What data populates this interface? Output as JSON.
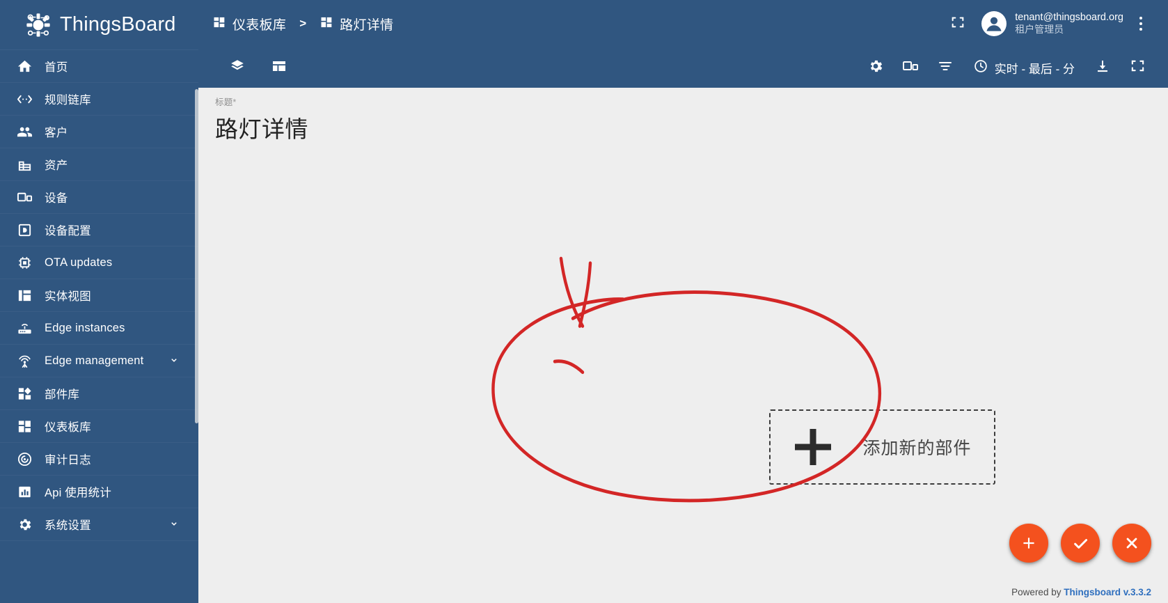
{
  "brand": {
    "name": "ThingsBoard",
    "logo_icon": "thingsboard-logo-icon"
  },
  "sidebar": {
    "items": [
      {
        "label": "首页",
        "icon": "home-icon",
        "expandable": false
      },
      {
        "label": "规则链库",
        "icon": "rule-chain-icon",
        "expandable": false
      },
      {
        "label": "客户",
        "icon": "customers-icon",
        "expandable": false
      },
      {
        "label": "资产",
        "icon": "assets-icon",
        "expandable": false
      },
      {
        "label": "设备",
        "icon": "devices-icon",
        "expandable": false
      },
      {
        "label": "设备配置",
        "icon": "device-profile-icon",
        "expandable": false
      },
      {
        "label": "OTA updates",
        "icon": "ota-chip-icon",
        "expandable": false
      },
      {
        "label": "实体视图",
        "icon": "entity-view-icon",
        "expandable": false
      },
      {
        "label": "Edge instances",
        "icon": "router-icon",
        "expandable": false
      },
      {
        "label": "Edge management",
        "icon": "edge-antenna-icon",
        "expandable": true
      },
      {
        "label": "部件库",
        "icon": "widget-library-icon",
        "expandable": false
      },
      {
        "label": "仪表板库",
        "icon": "dashboard-library-icon",
        "expandable": false
      },
      {
        "label": "审计日志",
        "icon": "audit-log-icon",
        "expandable": false
      },
      {
        "label": "Api 使用统计",
        "icon": "api-usage-icon",
        "expandable": false
      },
      {
        "label": "系统设置",
        "icon": "settings-gear-icon",
        "expandable": true
      }
    ]
  },
  "topbar": {
    "breadcrumb": [
      {
        "label": "仪表板库",
        "icon": "dashboard-library-icon"
      },
      {
        "label": "路灯详情",
        "icon": "dashboard-library-icon"
      }
    ],
    "separator": ">",
    "fullscreen_icon": "fullscreen-icon",
    "user": {
      "email": "tenant@thingsboard.org",
      "role": "租户管理员",
      "avatar_icon": "account-circle-icon"
    },
    "more_icon": "more-vertical-icon"
  },
  "dashboard_toolbar": {
    "left_icons": [
      {
        "icon": "layers-icon",
        "name": "dashboard-states-button"
      },
      {
        "icon": "dashboard-layout-icon",
        "name": "manage-layouts-button"
      }
    ],
    "right_icons": [
      {
        "icon": "gear-icon",
        "name": "dashboard-settings-button"
      },
      {
        "icon": "devices-icon",
        "name": "entity-aliases-button"
      },
      {
        "icon": "filter-icon",
        "name": "filters-button"
      }
    ],
    "timewindow": {
      "icon": "clock-icon",
      "label": "实时 - 最后 - 分"
    },
    "export_icon": "download-icon",
    "expand_icon": "fullscreen-icon"
  },
  "dashboard": {
    "title_label": "标题",
    "title_required_mark": "*",
    "title_value": "路灯详情",
    "add_widget": {
      "label": "添加新的部件",
      "plus_icon": "plus-icon"
    }
  },
  "fabs": [
    {
      "name": "add-widget-fab",
      "icon": "plus-icon"
    },
    {
      "name": "apply-changes-fab",
      "icon": "check-icon"
    },
    {
      "name": "cancel-changes-fab",
      "icon": "close-icon"
    }
  ],
  "footer": {
    "prefix": "Powered by ",
    "link": "Thingsboard v.3.3.2"
  },
  "annotation": {
    "color": "#d32626",
    "shapes": [
      "down-arrow",
      "ellipse-highlight"
    ]
  },
  "colors": {
    "primary_blue": "#305680",
    "accent_orange": "#f4511e",
    "content_bg": "#eeeeee",
    "annotation_red": "#d32626",
    "link_blue": "#2f6fbe"
  }
}
